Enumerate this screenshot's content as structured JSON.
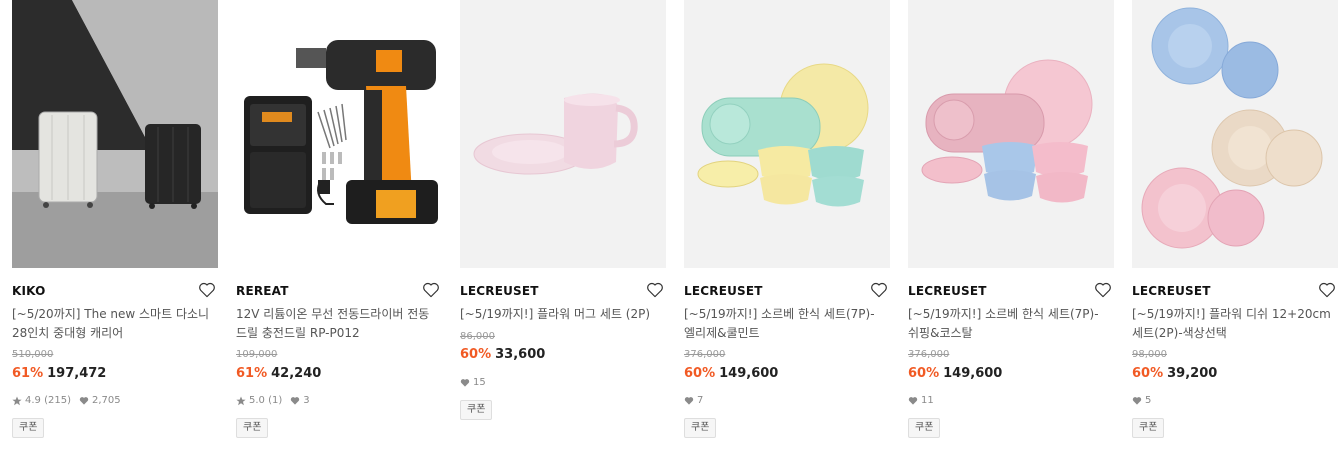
{
  "products": [
    {
      "brand": "KIKO",
      "name": "[~5/20까지] The new 스마트 다소니 28인치 중대형 캐리어",
      "original_price": "510,000",
      "discount": "61%",
      "price": "197,472",
      "rating": "4.9",
      "reviews": "(215)",
      "likes": "2,705",
      "coupon": "쿠폰"
    },
    {
      "brand": "REREAT",
      "name": "12V 리튬이온 무선 전동드라이버 전동드릴 충전드릴 RP-P012",
      "original_price": "109,000",
      "discount": "61%",
      "price": "42,240",
      "rating": "5.0",
      "reviews": "(1)",
      "likes": "3",
      "coupon": "쿠폰"
    },
    {
      "brand": "LECREUSET",
      "name": "[~5/19까지!] 플라워 머그 세트 (2P)",
      "original_price": "86,000",
      "discount": "60%",
      "price": "33,600",
      "likes": "15",
      "coupon": "쿠폰"
    },
    {
      "brand": "LECREUSET",
      "name": "[~5/19까지!] 소르베 한식 세트(7P)-엘리제&쿨민트",
      "original_price": "376,000",
      "discount": "60%",
      "price": "149,600",
      "likes": "7",
      "coupon": "쿠폰"
    },
    {
      "brand": "LECREUSET",
      "name": "[~5/19까지!] 소르베 한식 세트(7P)-쉬핑&코스탈",
      "original_price": "376,000",
      "discount": "60%",
      "price": "149,600",
      "likes": "11",
      "coupon": "쿠폰"
    },
    {
      "brand": "LECREUSET",
      "name": "[~5/19까지!] 플라워 디쉬 12+20cm세트(2P)-색상선택",
      "original_price": "98,000",
      "discount": "60%",
      "price": "39,200",
      "likes": "5",
      "coupon": "쿠폰"
    }
  ],
  "icons": {
    "wishlist": "heart-outline-icon",
    "rating": "star-icon",
    "likes": "heart-filled-icon"
  },
  "colors": {
    "discount": "#f15a24",
    "muted": "#8a8a8a",
    "thumb_bg": "#f2f2f2"
  }
}
